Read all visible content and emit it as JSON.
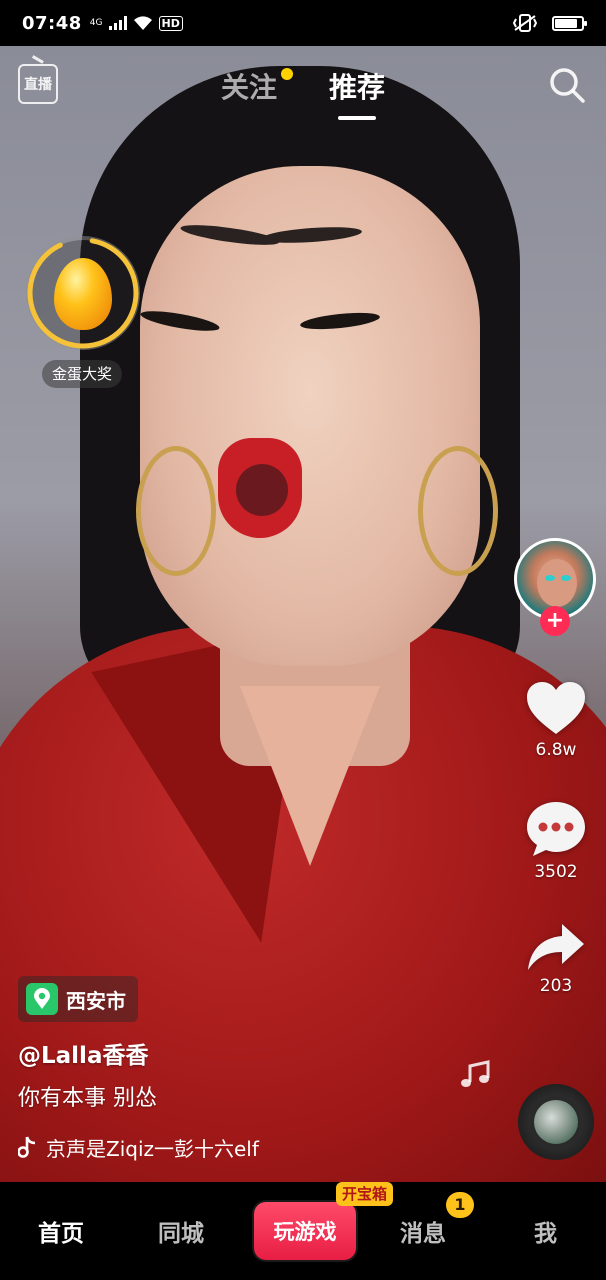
{
  "status_bar": {
    "time": "07:48",
    "network": "4G",
    "hd": "HD"
  },
  "top_nav": {
    "live_label": "直播",
    "tabs": [
      {
        "label": "关注",
        "has_dot": true
      },
      {
        "label": "推荐",
        "active": true
      }
    ]
  },
  "promo": {
    "egg_label": "金蛋大奖"
  },
  "right_rail": {
    "likes": "6.8w",
    "comments": "3502",
    "shares": "203",
    "follow_symbol": "+"
  },
  "video_info": {
    "location": "西安市",
    "username": "@Lalla香香",
    "caption": "你有本事 别怂",
    "sound": "京声是Ziqiz一彭十六elf　"
  },
  "bottom_nav": {
    "home": "首页",
    "city": "同城",
    "game": "玩游戏",
    "treasure_badge": "开宝箱",
    "messages": "消息",
    "messages_badge": "1",
    "me": "我"
  },
  "colors": {
    "accent": "#fe2c55",
    "badge": "#ffc21a",
    "location": "#29c76a"
  },
  "icons": [
    "live-icon",
    "search-icon",
    "egg-icon",
    "heart-icon",
    "comment-icon",
    "share-icon",
    "music-note-icon",
    "location-pin-icon",
    "tiktok-note-icon"
  ]
}
